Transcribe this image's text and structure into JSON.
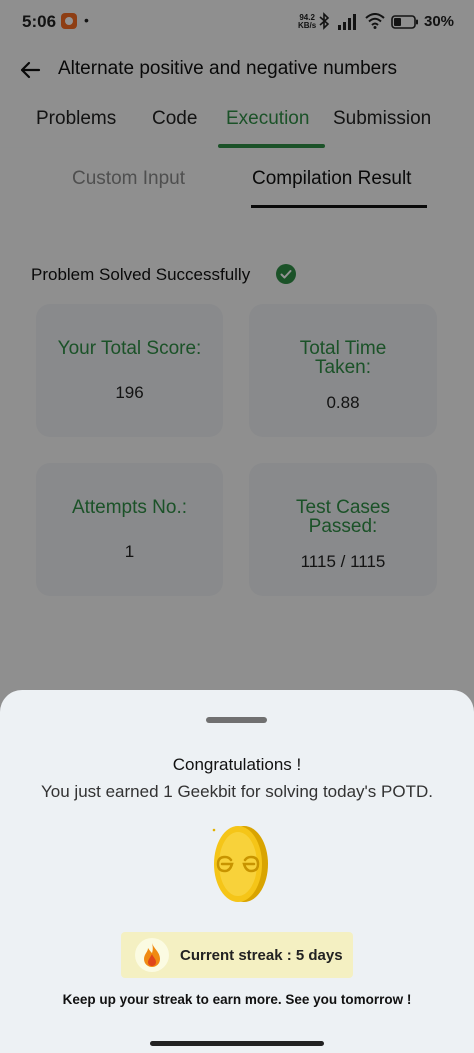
{
  "status_bar": {
    "time": "5:06",
    "network_speed_value": "94.2",
    "network_speed_unit": "KB/s",
    "battery": "30%"
  },
  "header": {
    "title": "Alternate positive and negative numbers",
    "tabs": [
      {
        "label": "Problems"
      },
      {
        "label": "Code"
      },
      {
        "label": "Execution",
        "active": true
      },
      {
        "label": "Submission"
      }
    ]
  },
  "subtabs": [
    {
      "label": "Custom Input"
    },
    {
      "label": "Compilation Result",
      "active": true
    }
  ],
  "result": {
    "status": "Problem Solved Successfully",
    "cards": [
      {
        "label": "Your Total Score:",
        "value": "196"
      },
      {
        "label": "Total Time Taken:",
        "value": "0.88"
      },
      {
        "label": "Attempts No.:",
        "value": "1"
      },
      {
        "label": "Test Cases Passed:",
        "value": "1115 / 1115"
      }
    ]
  },
  "sheet": {
    "title": "Congratulations !",
    "message": "You just earned 1 Geekbit for solving today's POTD.",
    "streak": "Current streak : 5 days",
    "footer": "Keep up your streak to earn more. See you tomorrow !"
  },
  "colors": {
    "accent": "#2f8d46",
    "coin": "#f5c518",
    "streak_bg": "#f4f0c2"
  }
}
